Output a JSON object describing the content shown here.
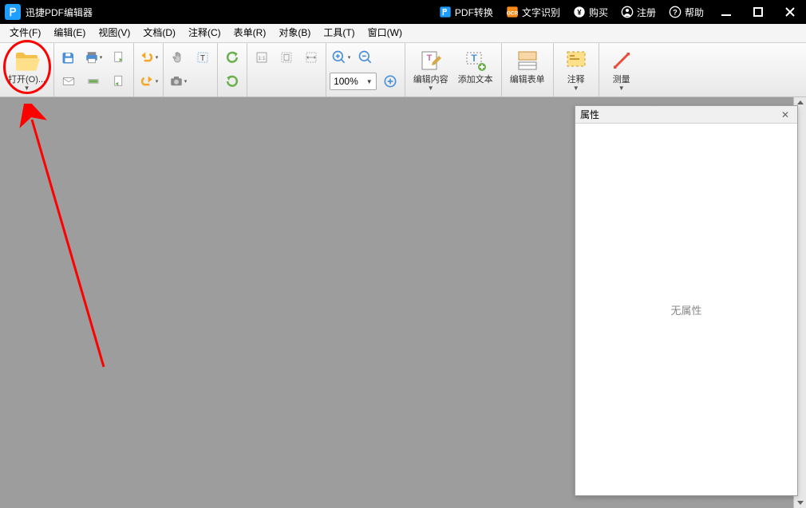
{
  "titlebar": {
    "app_title": "迅捷PDF编辑器",
    "pdf_convert": "PDF转换",
    "ocr": "文字识别",
    "buy": "购买",
    "register": "注册",
    "help": "帮助"
  },
  "menu": {
    "file": "文件(F)",
    "edit": "编辑(E)",
    "view": "视图(V)",
    "document": "文档(D)",
    "comment": "注释(C)",
    "form": "表单(R)",
    "object": "对象(B)",
    "tools": "工具(T)",
    "window": "窗口(W)"
  },
  "toolbar": {
    "open": "打开(O)...",
    "zoom_value": "100%",
    "edit_content": "编辑内容",
    "add_text": "添加文本",
    "edit_form": "编辑表单",
    "annotate": "注释",
    "measure": "测量"
  },
  "panel": {
    "title": "属性",
    "empty_text": "无属性"
  }
}
